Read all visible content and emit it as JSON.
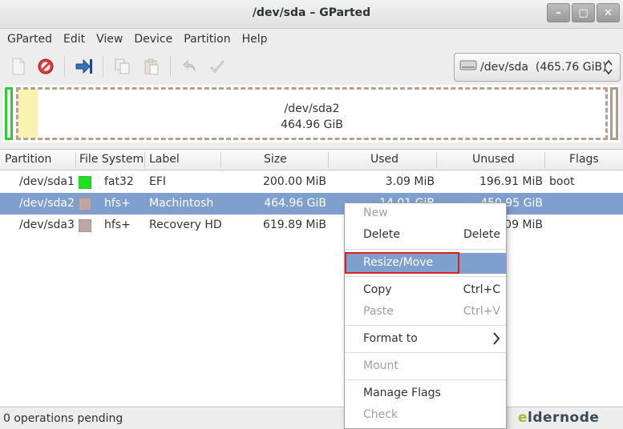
{
  "window": {
    "title": "/dev/sda – GParted"
  },
  "window_buttons": [
    "–",
    "□",
    "✕"
  ],
  "menu": [
    "GParted",
    "Edit",
    "View",
    "Device",
    "Partition",
    "Help"
  ],
  "toolbar_icons": [
    "new-icon",
    "delete-icon",
    "resize-move-icon",
    "copy-icon",
    "paste-icon",
    "undo-icon",
    "apply-icon"
  ],
  "device_selector": {
    "label": "/dev/sda  (465.76 GiB)"
  },
  "disk_graphic": {
    "partition": "/dev/sda2",
    "size": "464.96 GiB"
  },
  "table": {
    "columns": [
      "Partition",
      "File System",
      "Label",
      "Size",
      "Used",
      "Unused",
      "Flags"
    ],
    "rows": [
      {
        "partition": "/dev/sda1",
        "fs": "fat32",
        "fs_color": "#22dd22",
        "label": "EFI",
        "size": "200.00 MiB",
        "used": "3.09 MiB",
        "unused": "196.91 MiB",
        "flags": "boot"
      },
      {
        "partition": "/dev/sda2",
        "fs": "hfs+",
        "fs_color": "#bfa6a6",
        "label": "Machintosh",
        "size": "464.96 GiB",
        "used": "14.01 GiB",
        "unused": "450.95 GiB",
        "flags": ""
      },
      {
        "partition": "/dev/sda3",
        "fs": "hfs+",
        "fs_color": "#bfa6a6",
        "label": "Recovery HD",
        "size": "619.89 MiB",
        "used": "",
        "unused": "09 MiB",
        "flags": ""
      }
    ]
  },
  "status": "0 operations pending",
  "context_menu": {
    "items": [
      {
        "label": "New",
        "shortcut": "",
        "enabled": false
      },
      {
        "label": "Delete",
        "shortcut": "Delete",
        "enabled": true
      },
      {
        "label": "Resize/Move",
        "shortcut": "",
        "enabled": true,
        "highlighted": true
      },
      {
        "label": "Copy",
        "shortcut": "Ctrl+C",
        "enabled": true
      },
      {
        "label": "Paste",
        "shortcut": "Ctrl+V",
        "enabled": false
      },
      {
        "label": "Format to",
        "shortcut": "",
        "enabled": true,
        "submenu": true
      },
      {
        "label": "Mount",
        "shortcut": "",
        "enabled": false
      },
      {
        "label": "Manage Flags",
        "shortcut": "",
        "enabled": true
      },
      {
        "label": "Check",
        "shortcut": "",
        "enabled": false
      }
    ]
  },
  "watermark": {
    "first": "e",
    "rest": "ldernode"
  },
  "colors": {
    "selection": "#7f9fcf",
    "highlight_box": "#e02020"
  }
}
